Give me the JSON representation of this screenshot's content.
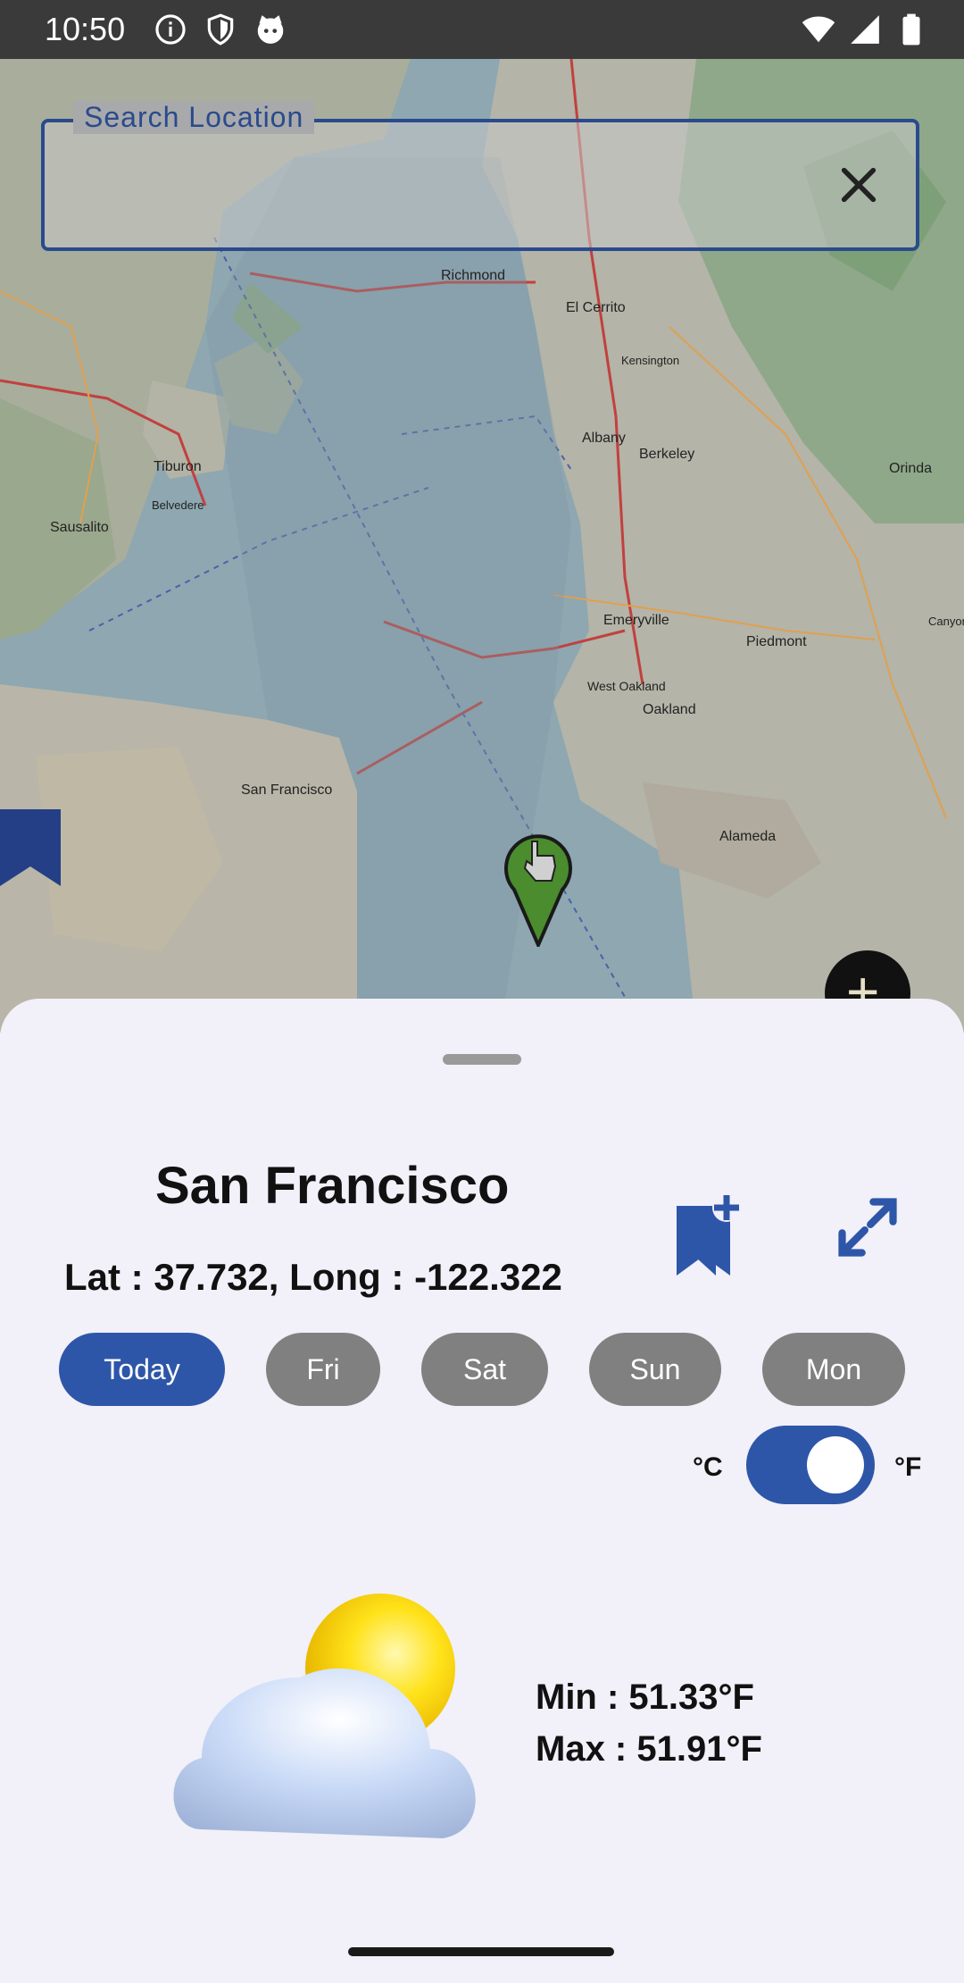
{
  "status_bar": {
    "time": "10:50",
    "left_icons": [
      "info-icon",
      "shield-icon",
      "cat-icon"
    ],
    "right_icons": [
      "wifi-icon",
      "signal-icon",
      "battery-icon"
    ]
  },
  "map": {
    "labels": [
      "Richmond",
      "El Cerrito",
      "Tiburon",
      "Albany",
      "Berkeley",
      "Orinda",
      "Sausalito",
      "Emeryville",
      "Piedmont",
      "Oakland",
      "West Oakland",
      "San Francisco",
      "Alameda",
      "Belvedere",
      "Kensington",
      "Canyon"
    ]
  },
  "search": {
    "label": "Search Location",
    "value": "",
    "placeholder": ""
  },
  "location": {
    "city": "San Francisco",
    "coordinates": "Lat : 37.732, Long : -122.322"
  },
  "days": [
    "Today",
    "Fri",
    "Sat",
    "Sun",
    "Mon"
  ],
  "active_day": "Today",
  "units": {
    "celsius": "°C",
    "fahrenheit": "°F",
    "selected": "°F"
  },
  "weather": {
    "icon": "partly-cloudy-icon",
    "min": "Min : 51.33°F",
    "max": "Max : 51.91°F"
  },
  "colors": {
    "accent": "#2e56a8",
    "inactive_tab": "#808080"
  }
}
